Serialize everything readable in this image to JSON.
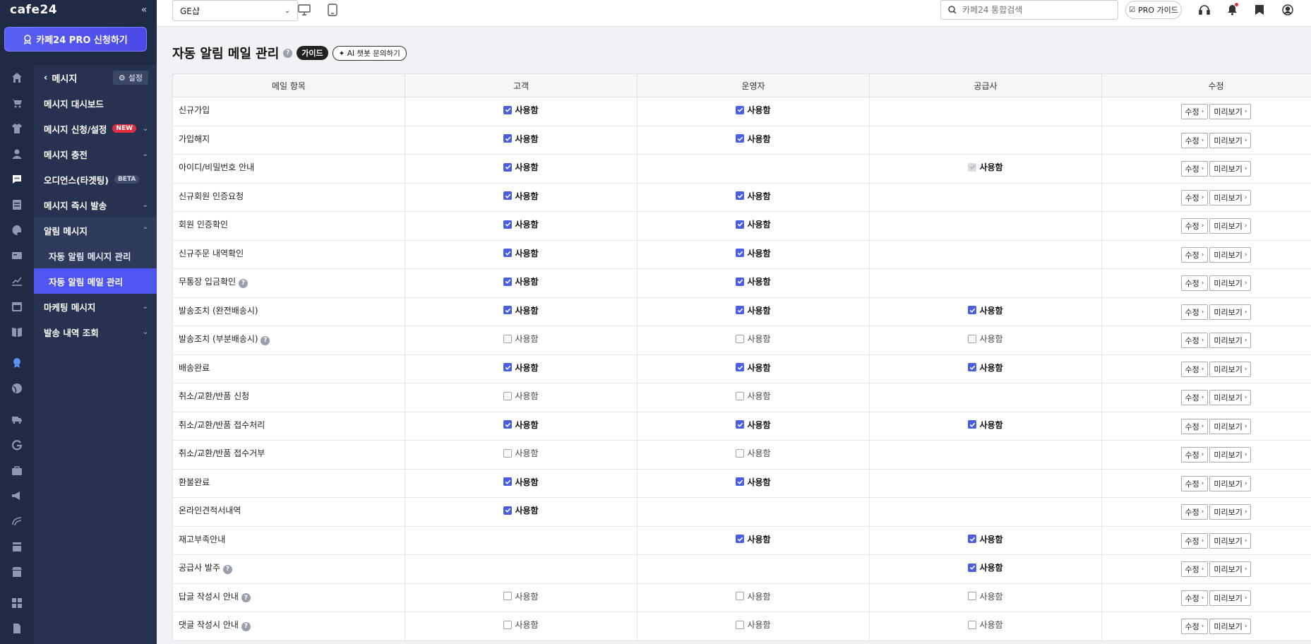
{
  "brand": {
    "logo": "cafe24"
  },
  "sidebar": {
    "pro_button": "카페24 PRO 신청하기",
    "back_label": "메시지",
    "settings_label": "설정",
    "menu": [
      {
        "label": "메시지 대시보드",
        "chevron": false
      },
      {
        "label": "메시지 신청/설정",
        "badge": "NEW",
        "chevron": true
      },
      {
        "label": "메시지 충전",
        "chevron": true
      },
      {
        "label": "오디언스(타겟팅)",
        "badge": "BETA",
        "chevron": false
      },
      {
        "label": "메시지 즉시 발송",
        "chevron": true
      },
      {
        "label": "알림 메시지",
        "chevron": true,
        "open": true
      },
      {
        "label": "마케팅 메시지",
        "chevron": true
      },
      {
        "label": "발송 내역 조회",
        "chevron": true
      }
    ],
    "submenu": [
      {
        "label": "자동 알림 메시지 관리",
        "active": false
      },
      {
        "label": "자동 알림 메일 관리",
        "active": true
      }
    ]
  },
  "topbar": {
    "shop_select": "GE샵",
    "search_placeholder": "카페24 통합검색",
    "pro_guide": "PRO 가이드"
  },
  "page": {
    "title": "자동 알림 메일 관리",
    "guide_badge": "가이드",
    "ai_button": "AI 챗봇 문의하기"
  },
  "table": {
    "headers": [
      "메일 항목",
      "고객",
      "운영자",
      "공급사",
      "수정"
    ],
    "use_label": "사용함",
    "edit_label": "수정",
    "preview_label": "미리보기",
    "rows": [
      {
        "name": "신규가입",
        "help": false,
        "c": "on",
        "o": "on",
        "s": "none"
      },
      {
        "name": "가입해지",
        "help": false,
        "c": "on",
        "o": "on",
        "s": "none"
      },
      {
        "name": "아이디/비밀번호 안내",
        "help": false,
        "c": "on",
        "o": "none",
        "s": "dis"
      },
      {
        "name": "신규회원 인증요청",
        "help": false,
        "c": "on",
        "o": "on",
        "s": "none"
      },
      {
        "name": "회원 인증확인",
        "help": false,
        "c": "on",
        "o": "on",
        "s": "none"
      },
      {
        "name": "신규주문 내역확인",
        "help": false,
        "c": "on",
        "o": "on",
        "s": "none"
      },
      {
        "name": "무통장 입금확인",
        "help": true,
        "c": "on",
        "o": "on",
        "s": "none"
      },
      {
        "name": "발송조치 (완전배송시)",
        "help": false,
        "c": "on",
        "o": "on",
        "s": "on"
      },
      {
        "name": "발송조치 (부분배송시)",
        "help": true,
        "c": "off",
        "o": "off",
        "s": "off"
      },
      {
        "name": "배송완료",
        "help": false,
        "c": "on",
        "o": "on",
        "s": "on"
      },
      {
        "name": "취소/교환/반품 신청",
        "help": false,
        "c": "off",
        "o": "off",
        "s": "none"
      },
      {
        "name": "취소/교환/반품 접수처리",
        "help": false,
        "c": "on",
        "o": "on",
        "s": "on"
      },
      {
        "name": "취소/교환/반품 접수거부",
        "help": false,
        "c": "off",
        "o": "off",
        "s": "none"
      },
      {
        "name": "환불완료",
        "help": false,
        "c": "on",
        "o": "on",
        "s": "none"
      },
      {
        "name": "온라인견적서내역",
        "help": false,
        "c": "on",
        "o": "none",
        "s": "none"
      },
      {
        "name": "재고부족안내",
        "help": false,
        "c": "none",
        "o": "on",
        "s": "on"
      },
      {
        "name": "공급사 발주",
        "help": true,
        "c": "none",
        "o": "none",
        "s": "on"
      },
      {
        "name": "답글 작성시 안내",
        "help": true,
        "c": "off",
        "o": "off",
        "s": "off"
      },
      {
        "name": "댓글 작성시 안내",
        "help": true,
        "c": "off",
        "o": "off",
        "s": "off"
      }
    ]
  },
  "colors": {
    "sidebar_bg": "#1f2a44",
    "menu_bg": "#26324f",
    "accent": "#4f55f0",
    "checkbox_on": "#4a5fe0",
    "badge_new": "#e0303f"
  }
}
